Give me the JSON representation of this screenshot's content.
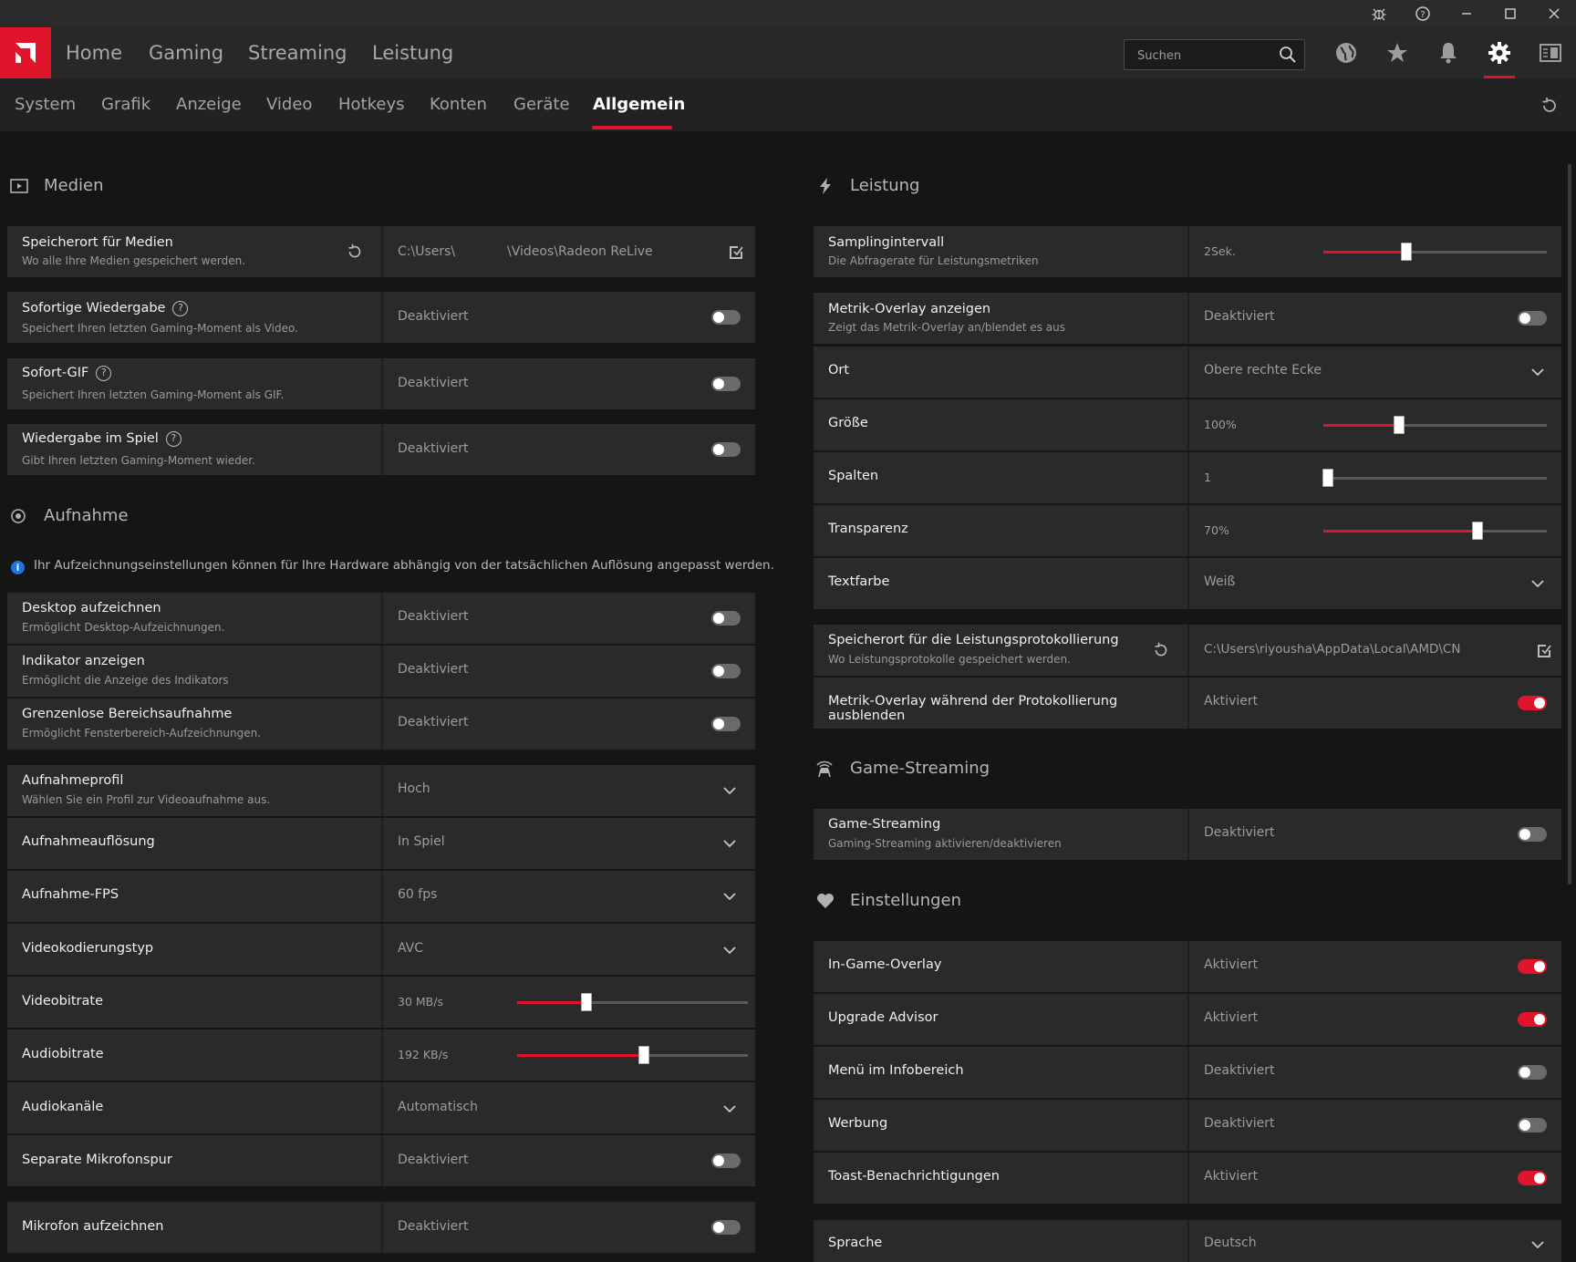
{
  "nav": {
    "tabs": [
      "Home",
      "Gaming",
      "Streaming",
      "Leistung"
    ],
    "search_placeholder": "Suchen"
  },
  "subnav": {
    "tabs": [
      "System",
      "Grafik",
      "Anzeige",
      "Video",
      "Hotkeys",
      "Konten",
      "Geräte",
      "Allgemein"
    ],
    "active": "Allgemein"
  },
  "colors": {
    "accent": "#e0152c",
    "info": "#1a73e8"
  },
  "left": {
    "medien": {
      "title": "Medien",
      "speicherort": {
        "label": "Speicherort für Medien",
        "desc": "Wo alle Ihre Medien gespeichert werden.",
        "path_start": "C:\\Users\\",
        "path_end": "\\Videos\\Radeon ReLive"
      },
      "sofortige": {
        "label": "Sofortige Wiedergabe",
        "desc": "Speichert Ihren letzten Gaming-Moment als Video.",
        "value": "Deaktiviert",
        "on": false
      },
      "gif": {
        "label": "Sofort-GIF",
        "desc": "Speichert Ihren letzten Gaming-Moment als GIF.",
        "value": "Deaktiviert",
        "on": false
      },
      "wiedergabe": {
        "label": "Wiedergabe im Spiel",
        "desc": "Gibt Ihren letzten Gaming-Moment wieder.",
        "value": "Deaktiviert",
        "on": false
      }
    },
    "aufnahme": {
      "title": "Aufnahme",
      "info": "Ihr Aufzeichnungseinstellungen können für Ihre Hardware abhängig von der tatsächlichen Auflösung angepasst werden.",
      "desktop": {
        "label": "Desktop aufzeichnen",
        "desc": "Ermöglicht Desktop-Aufzeichnungen.",
        "value": "Deaktiviert",
        "on": false
      },
      "indikator": {
        "label": "Indikator anzeigen",
        "desc": "Ermöglicht die Anzeige des Indikators",
        "value": "Deaktiviert",
        "on": false
      },
      "grenzenlos": {
        "label": "Grenzenlose Bereichsaufnahme",
        "desc": "Ermöglicht Fensterbereich-Aufzeichnungen.",
        "value": "Deaktiviert",
        "on": false
      },
      "profil": {
        "label": "Aufnahmeprofil",
        "desc": "Wählen Sie ein Profil zur Videoaufnahme aus.",
        "value": "Hoch"
      },
      "aufloesung": {
        "label": "Aufnahmeauflösung",
        "value": "In Spiel"
      },
      "fps": {
        "label": "Aufnahme-FPS",
        "value": "60 fps"
      },
      "kodierung": {
        "label": "Videokodierungstyp",
        "value": "AVC"
      },
      "videobitrate": {
        "label": "Videobitrate",
        "value": "30 MB/s",
        "fraction": 0.3
      },
      "audiobitrate": {
        "label": "Audiobitrate",
        "value": "192 KB/s",
        "fraction": 0.55
      },
      "kanaele": {
        "label": "Audiokanäle",
        "value": "Automatisch"
      },
      "mikrofonspur": {
        "label": "Separate Mikrofonspur",
        "value": "Deaktiviert",
        "on": false
      },
      "mikrofon": {
        "label": "Mikrofon aufzeichnen",
        "value": "Deaktiviert",
        "on": false
      }
    }
  },
  "right": {
    "leistung": {
      "title": "Leistung",
      "sampling": {
        "label": "Samplingintervall",
        "desc": "Die Abfragerate für Leistungsmetriken",
        "value": "2Sek.",
        "fraction": 0.37
      },
      "overlay": {
        "label": "Metrik-Overlay anzeigen",
        "desc": "Zeigt das Metrik-Overlay an/blendet es aus",
        "value": "Deaktiviert",
        "on": false
      },
      "ort": {
        "label": "Ort",
        "value": "Obere rechte Ecke"
      },
      "groesse": {
        "label": "Größe",
        "value": "100%",
        "fraction": 0.34
      },
      "spalten": {
        "label": "Spalten",
        "value": "1",
        "fraction": 0.02
      },
      "transparenz": {
        "label": "Transparenz",
        "value": "70%",
        "fraction": 0.69
      },
      "textfarbe": {
        "label": "Textfarbe",
        "value": "Weiß"
      },
      "protokoll": {
        "label": "Speicherort für die Leistungsprotokollierung",
        "desc": "Wo Leistungsprotokolle gespeichert werden.",
        "value": "C:\\Users\\riyousha\\AppData\\Local\\AMD\\CN"
      },
      "ausblenden": {
        "label": "Metrik-Overlay während der Protokollierung ausblenden",
        "value": "Aktiviert",
        "on": true
      }
    },
    "streaming": {
      "title": "Game-Streaming",
      "game": {
        "label": "Game-Streaming",
        "desc": "Gaming-Streaming aktivieren/deaktivieren",
        "value": "Deaktiviert",
        "on": false
      }
    },
    "einstellungen": {
      "title": "Einstellungen",
      "ingame": {
        "label": "In-Game-Overlay",
        "value": "Aktiviert",
        "on": true
      },
      "upgrade": {
        "label": "Upgrade Advisor",
        "value": "Aktiviert",
        "on": true
      },
      "menue": {
        "label": "Menü im Infobereich",
        "value": "Deaktiviert",
        "on": false
      },
      "werbung": {
        "label": "Werbung",
        "value": "Deaktiviert",
        "on": false
      },
      "toast": {
        "label": "Toast-Benachrichtigungen",
        "value": "Aktiviert",
        "on": true
      },
      "sprache": {
        "label": "Sprache",
        "value": "Deutsch"
      }
    }
  }
}
